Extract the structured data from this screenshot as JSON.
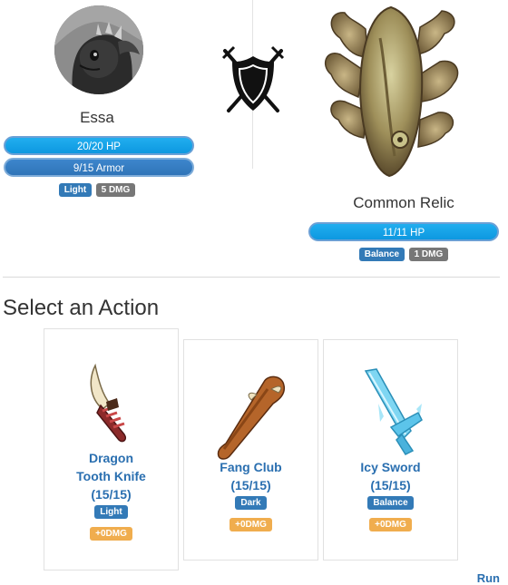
{
  "player": {
    "name": "Essa",
    "hp_text": "20/20 HP",
    "hp_fraction": 1.0,
    "armor_text": "9/15 Armor",
    "armor_fraction": 0.6,
    "badges": [
      "Light",
      "5 DMG"
    ]
  },
  "enemy": {
    "name": "Common Relic",
    "hp_text": "11/11 HP",
    "hp_fraction": 1.0,
    "badges": [
      "Balance",
      "1 DMG"
    ]
  },
  "section_title": "Select an Action",
  "actions": [
    {
      "name_line1": "Dragon",
      "name_line2": "Tooth Knife",
      "uses": "(15/15)",
      "element": "Light",
      "dmg": "+0DMG",
      "icon": "dragon-tooth-knife-icon"
    },
    {
      "name_line1": "Fang Club",
      "uses": "(15/15)",
      "element": "Dark",
      "dmg": "+0DMG",
      "icon": "fang-club-icon"
    },
    {
      "name_line1": "Icy Sword",
      "uses": "(15/15)",
      "element": "Balance",
      "dmg": "+0DMG",
      "icon": "icy-sword-icon"
    }
  ],
  "run_label": "Run",
  "colors": {
    "hp_bar": "#0d98e0",
    "armor_bar": "#2f74b8",
    "badge_blue": "#337ab7",
    "badge_gray": "#777777",
    "badge_orange": "#f0ad4e",
    "link_blue": "#2a6fb0"
  }
}
